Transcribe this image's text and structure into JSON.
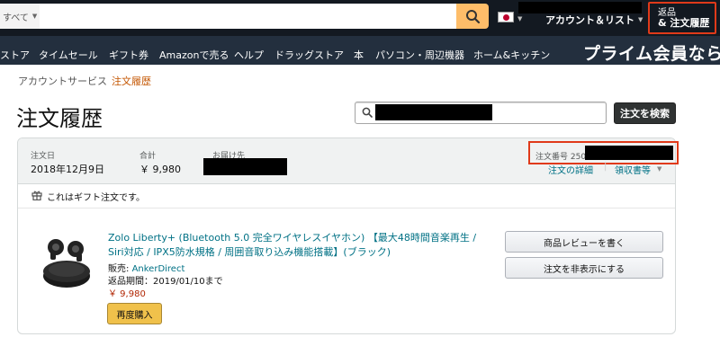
{
  "header": {
    "category_label": "すべて",
    "account_lists": "アカウント＆リスト",
    "returns_line1": "返品",
    "returns_line2": "& 注文履歴"
  },
  "nav": {
    "items": [
      "ストア",
      "タイムセール",
      "ギフト券",
      "Amazonで売る",
      "ヘルプ",
      "ドラッグストア",
      "本",
      "パソコン・周辺機器",
      "ホーム&キッチン"
    ],
    "prime_banner": "プライム会員なら"
  },
  "breadcrumb": {
    "parent": "アカウントサービス",
    "separator": "›",
    "current": "注文履歴"
  },
  "page": {
    "title": "注文履歴",
    "search_button": "注文を検索"
  },
  "order": {
    "date_label": "注文日",
    "date_value": "2018年12月9日",
    "total_label": "合計",
    "total_value": "￥ 9,980",
    "ship_label": "お届け先",
    "order_number_label": "注文番号 250-",
    "details_link": "注文の詳細",
    "receipt_link": "領収書等",
    "gift_notice": "これはギフト注文です。"
  },
  "item": {
    "title": "Zolo Liberty+ (Bluetooth 5.0 完全ワイヤレスイヤホン) 【最大48時間音楽再生 / Siri対応 / IPX5防水規格 / 周囲音取り込み機能搭載】(ブラック)",
    "seller_prefix": "販売:",
    "seller_name": "AnkerDirect",
    "return_period": "返品期間：2019/01/10まで",
    "price": "￥ 9,980",
    "rebuy_button": "再度購入",
    "review_button": "商品レビューを書く",
    "hide_button": "注文を非表示にする"
  },
  "colors": {
    "topbar": "#131921",
    "navbar": "#232f3e",
    "search_button": "#febd69",
    "highlight_box": "#e03a1a",
    "link": "#007185",
    "price": "#b12704",
    "breadcrumb_current": "#c45500",
    "rebuy_button": "#f0c14b"
  }
}
